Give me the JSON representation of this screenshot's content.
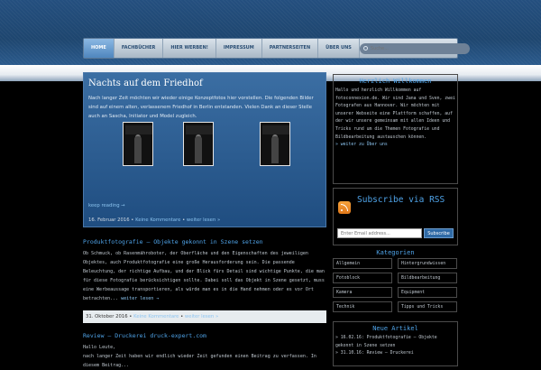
{
  "nav": {
    "items": [
      "HOME",
      "FACHBÜCHER",
      "HIER WERBEN!",
      "IMPRESSUM",
      "PARTNERSEITEN",
      "ÜBER UNS"
    ],
    "search_placeholder": "Suche..."
  },
  "featured": {
    "title": "Nachts auf dem Friedhof",
    "text": "Nach langer Zeit möchten wir wieder einige Konzeptfotos hier vorstellen. Die folgenden Bilder sind auf einem alten, verlassenem Friedhof in Berlin entstanden. Vielen Dank an dieser Stelle auch an Sascha, Initiator und Model zugleich.",
    "keep_reading": "keep reading →",
    "date": "16. Februar 2016",
    "comments": "Keine Kommentare",
    "read_more": "weiter lesen »"
  },
  "post2": {
    "title": "Produktfotografie – Objekte gekonnt in Szene setzen",
    "text": "Ob Schmuck, ob Rasenmähroboter, der Oberfläche und den Eigenschaften des jeweiligen Objektes, auch Produktfotografie eine große Herausforderung sein. Die passende Beleuchtung, der richtige Aufbau, und der Blick fürs Detail sind wichtige Punkte, die man für diese Fotografie berücksichtigen sollte. Dabei soll das Objekt in Szene gesetzt, muss eine Werbeaussage transportieren, als würde man es in die Hand nehmen oder es vor Ort betrachten...",
    "read_more_inline": "weiter lesen →",
    "date": "31. Oktober 2016",
    "comments": "Keine Kommentare",
    "read_more": "weiter lesen »"
  },
  "post3": {
    "title": "Review – Druckerei druck-expert.com",
    "text1": "Hallo Leute,",
    "text2": "nach langer Zeit haben wir endlich wieder Zeit gefunden einen Beitrag zu verfassen. In diesem Beitrag..."
  },
  "welcome": {
    "title": "Herzlich Willkommen",
    "text": "Hallo und herzlich Willkommen auf fotoconnexion.de. Wir sind Jana und Sven, zwei Fotografen aus Hannover. Wir möchten mit unserer Webseite eine Plattform schaffen, auf der wir unsere gemeinsam mit allen Ideen und Tricks rund um die Themen Fotografie und Bildbearbeitung austauschen können.",
    "more": "» weiter zu Über uns"
  },
  "rss": {
    "title": "Subscribe via RSS",
    "email_placeholder": "Enter Email address...",
    "button": "Subscribe"
  },
  "categories": {
    "title": "Kategorien",
    "items": [
      "Allgemein",
      "Hintergrundwissen",
      "Fotoblock",
      "Bildbearbeitung",
      "Kamera",
      "Equipment",
      "Technik",
      "Tipps und Tricks"
    ]
  },
  "new_articles": {
    "title": "Neue Artikel",
    "items": [
      "» 16.02.16: Produktfotografie – Objekte gekonnt in Szene setzen",
      "» 31.10.16: Review – Druckerei"
    ]
  },
  "colors": {
    "accent": "#4fa3e8",
    "featured_bg": "#2b5d91",
    "page_bg": "#000000"
  }
}
